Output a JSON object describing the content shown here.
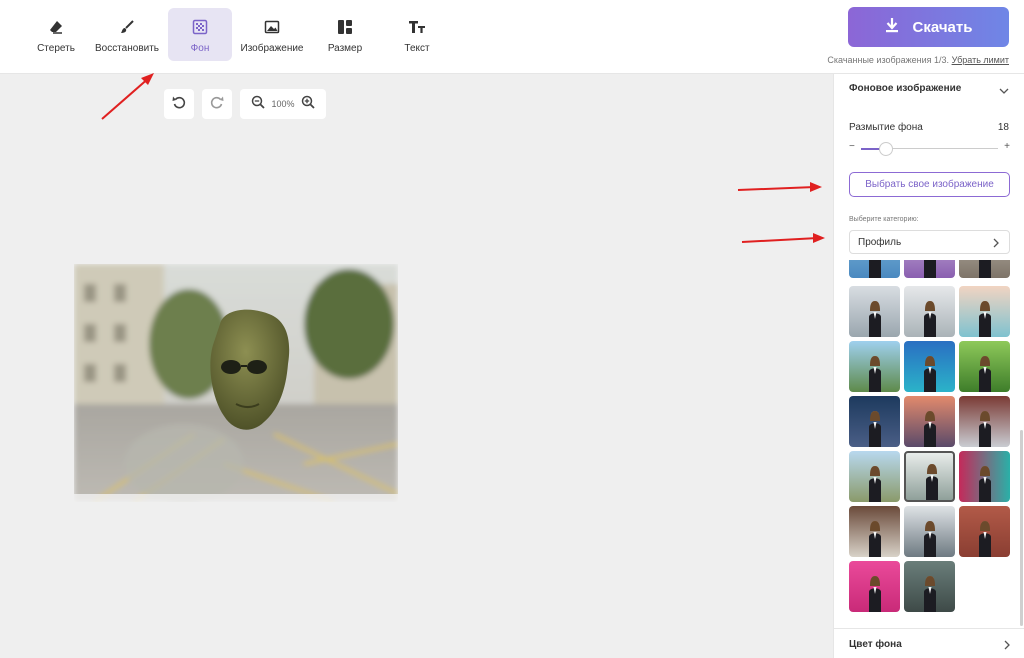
{
  "toolbar": {
    "tools": [
      {
        "label": "Стереть",
        "icon": "eraser-icon"
      },
      {
        "label": "Восстановить",
        "icon": "brush-icon"
      },
      {
        "label": "Фон",
        "icon": "background-icon",
        "active": true
      },
      {
        "label": "Изображение",
        "icon": "image-icon"
      },
      {
        "label": "Размер",
        "icon": "layout-icon"
      },
      {
        "label": "Текст",
        "icon": "text-icon"
      }
    ],
    "download_label": "Скачать",
    "download_info": "Скачанные изображения 1/3.",
    "limit_link": "Убрать лимит"
  },
  "canvas": {
    "zoom": "100%",
    "undo_icon": "undo-icon",
    "redo_icon": "redo-icon"
  },
  "panel": {
    "section_title": "Фоновое изображение",
    "blur_label": "Размытие фона",
    "blur_value": "18",
    "blur_fraction": 0.18,
    "choose_button": "Выбрать свое изображение",
    "category_label": "Выберите категорию:",
    "category_value": "Профиль",
    "bg_color_label": "Цвет фона",
    "slider_minus": "−",
    "slider_plus": "+"
  },
  "colors": {
    "accent": "#7b63c8",
    "download_gradient_start": "#8c66d6",
    "download_gradient_end": "#6f86e6",
    "arrow": "#e02020"
  }
}
